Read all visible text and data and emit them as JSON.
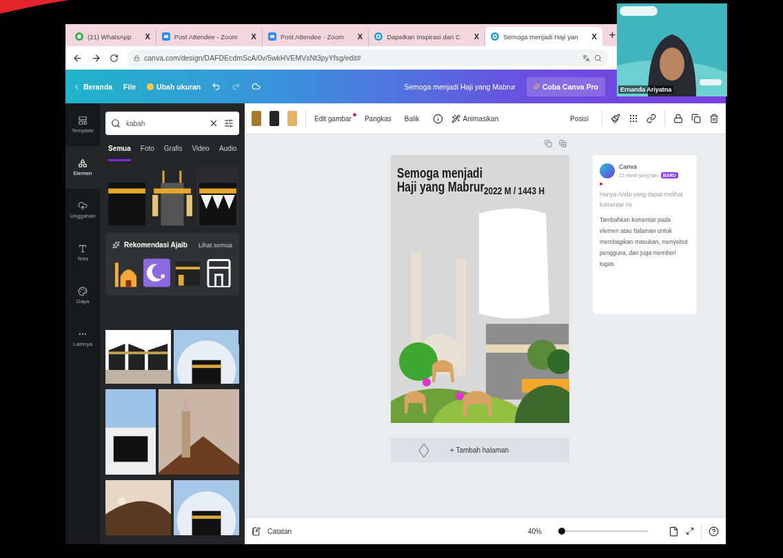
{
  "browser": {
    "tabs": [
      {
        "kind": "whatsapp",
        "label": "(21) WhatsApp",
        "close": "X",
        "selected": false
      },
      {
        "kind": "zoom",
        "label": "Post Attendee - Zoom",
        "close": "X",
        "selected": false
      },
      {
        "kind": "zoom",
        "label": "Post Attendee - Zoom",
        "close": "X",
        "selected": false
      },
      {
        "kind": "canva",
        "label": "Dapatkan Inspirasi dari C",
        "close": "X",
        "selected": false
      },
      {
        "kind": "canva",
        "label": "Semoga menjadi Haji yan",
        "close": "X",
        "selected": true
      }
    ],
    "new_tab": "+",
    "url": "canva.com/design/DAFDEcdmScA/0v/5wkHVEMVsNt3pyYfsg/edit#"
  },
  "header": {
    "back": "Beranda",
    "file": "File",
    "resize": "Ubah ukuran",
    "title": "Semoga menjadi Haji yang Mabrur",
    "pro": "Coba Canva Pro"
  },
  "rail": [
    {
      "kind": "template",
      "label": "Template",
      "selected": false
    },
    {
      "kind": "elements",
      "label": "Elemen",
      "selected": true
    },
    {
      "kind": "upload",
      "label": "Unggahan",
      "selected": false
    },
    {
      "kind": "text",
      "label": "Teks",
      "selected": false
    },
    {
      "kind": "style",
      "label": "Gaya",
      "selected": false
    },
    {
      "kind": "more",
      "label": "Lainnya",
      "selected": false
    }
  ],
  "search": {
    "value": "kabah"
  },
  "filters": [
    {
      "label": "Semua",
      "selected": true
    },
    {
      "label": "Foto",
      "selected": false
    },
    {
      "label": "Grafis",
      "selected": false
    },
    {
      "label": "Video",
      "selected": false
    },
    {
      "label": "Audio",
      "selected": false
    }
  ],
  "recommend": {
    "title": "Rekomendasi Ajaib",
    "link": "Lihat semua"
  },
  "toolbar": {
    "swatches": [
      {
        "color": "#a77a2a"
      },
      {
        "color": "#24252b"
      },
      {
        "color": "#e2b46a"
      }
    ],
    "items": [
      {
        "kind": "text",
        "label": "Edit gambar",
        "dot": true
      },
      {
        "kind": "text",
        "label": "Pangkas",
        "dot": false
      },
      {
        "kind": "text",
        "label": "Balik",
        "dot": false
      },
      {
        "kind": "info"
      },
      {
        "kind": "animate",
        "label": "Animasikan",
        "dot": false
      }
    ],
    "position": "Posisi"
  },
  "design": {
    "title_lines": [
      "Semoga menjadi",
      "Haji yang Mabrur"
    ],
    "year": "2022 M  / 1443 H"
  },
  "add_page": "+ Tambah halaman",
  "comment": {
    "author": "Canva",
    "time": "22 menit yang lalu",
    "badge": "BARU",
    "note": "Hanya Anda yang dapat melihat komentar ini",
    "body": "Tambahkan komentar pada elemen atau halaman untuk membagikan masukan, menyebut pengguna, dan juga memberi tugas"
  },
  "footer": {
    "notes": "Catatan",
    "zoom": "40%",
    "level": 0.04
  },
  "webcam": {
    "name": "Ernanda Ariyatna"
  }
}
